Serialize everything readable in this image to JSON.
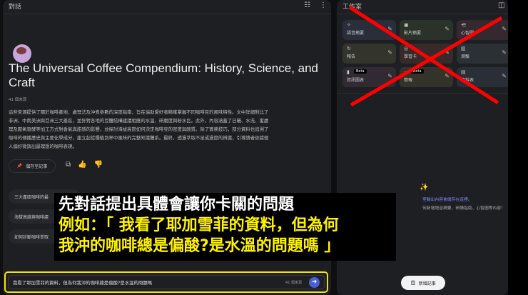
{
  "chat": {
    "header": "對話",
    "title": "The Universal Coffee Compendium: History, Science, and Craft",
    "source_count": "41 個來源",
    "summary": "這些來源提供了關於咖啡產地、處理法及沖煮參數的深度指南，旨在協助愛好者精確掌握不同咖啡豆的風味特性。文中詳細對比了非洲、中南美洲與亞洲三大產區，並針對各地的豆體結構建議相應的水溫、研磨度與粉水比。此外，內容涵蓋了日曬、水洗、蜜處理及厭氧發酵等加工方式對香氣與甜感的影響，並探討海拔高度如何決定咖啡豆的密度與酸質。除了實務技巧，部分資料也追溯了咖啡的傳播歷史與主要化學成分，建立起從種植到杯中風味的完整知識體系。最終，透過萃取不足或過度的辨識，引導讀者依據個人偏好微調出最理想的咖啡表現。",
    "save_note": "儲存至記事",
    "suggestions": [
      "三大產區咖啡的最",
      "海拔高度與咖啡處",
      "如何診斷咖啡萃取"
    ],
    "input_value": "我看了耶加雪菲的資料，但為何我沖的咖啡總是偏酸?是水溫的問題嗎",
    "input_source_count": "41 個來源"
  },
  "studio": {
    "header": "工作室",
    "tiles": [
      {
        "label": "語音摘要",
        "bg": "#2a2e3a"
      },
      {
        "label": "影片摘要",
        "bg": "#2b3229"
      },
      {
        "label": "心智圖",
        "bg": "#33292f"
      },
      {
        "label": "報告",
        "bg": "#34352a"
      },
      {
        "label": "學習卡",
        "bg": "#362b2a"
      },
      {
        "label": "測驗",
        "bg": "#2a3033"
      },
      {
        "label": "資訊圖表",
        "badge": "Beta",
        "bg": "#322a33"
      },
      {
        "label": "簡報",
        "badge": "Beta",
        "bg": "#33332a"
      },
      {
        "label": "資料表",
        "bg": "#2a2e36"
      }
    ],
    "empty_line1": "室輸出內容會儲存在這裡。",
    "empty_line2": "何新增語音摘要、研讀指南、心智圖等內容！",
    "new_note": "新增記事"
  },
  "overlay": {
    "line1": "先對話提出具體會讓你卡關的問題",
    "line2": "例如：「 我看了耶加雪菲的資料，但為何",
    "line3": "我沖的咖啡總是偏酸?是水溫的問題嗎 」"
  },
  "colors": {
    "highlight": "#f2e400",
    "cross": "#ff0000"
  }
}
